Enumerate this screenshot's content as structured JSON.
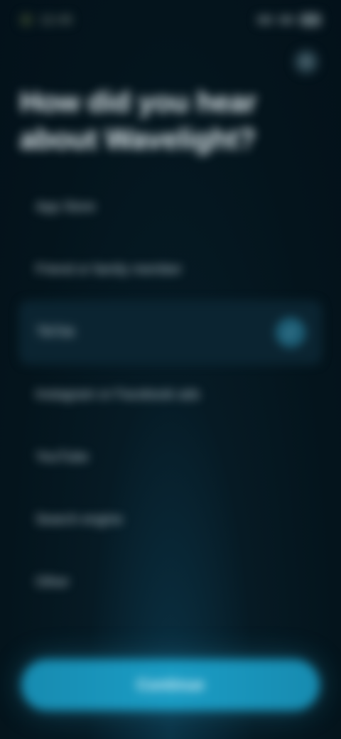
{
  "status_bar": {
    "time": "12:45"
  },
  "header": {
    "close_icon": "close-icon"
  },
  "question": {
    "title": "How did you hear about Wavelight?"
  },
  "options": [
    {
      "label": "App Store",
      "selected": false
    },
    {
      "label": "Friend or family member",
      "selected": false
    },
    {
      "label": "TikTok",
      "selected": true
    },
    {
      "label": "Instagram or Facebook ads",
      "selected": false
    },
    {
      "label": "YouTube",
      "selected": false
    },
    {
      "label": "Search engine",
      "selected": false
    },
    {
      "label": "Other",
      "selected": false
    }
  ],
  "footer": {
    "continue_label": "Continue"
  },
  "colors": {
    "accent": "#1a9cc4",
    "background": "#04141c"
  }
}
